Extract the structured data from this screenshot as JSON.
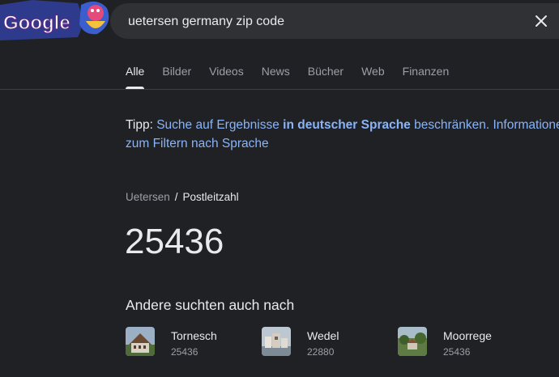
{
  "search": {
    "query": "uetersen germany zip code",
    "clear_icon": "close-icon"
  },
  "logo": {
    "text": "Google",
    "style": "doodle"
  },
  "tabs": [
    {
      "label": "Alle",
      "active": true
    },
    {
      "label": "Bilder",
      "active": false
    },
    {
      "label": "Videos",
      "active": false
    },
    {
      "label": "News",
      "active": false
    },
    {
      "label": "Bücher",
      "active": false
    },
    {
      "label": "Web",
      "active": false
    },
    {
      "label": "Finanzen",
      "active": false
    }
  ],
  "tip": {
    "prefix": "Tipp:",
    "link_start": "Suche auf Ergebnisse",
    "link_bold": "in deutscher Sprache",
    "link_end": "beschränken.",
    "link2": "Informationen zum Filtern nach Sprache"
  },
  "result": {
    "breadcrumb": [
      "Uetersen",
      "Postleitzahl"
    ],
    "separator": "/",
    "answer": "25436"
  },
  "related": {
    "title": "Andere suchten auch nach",
    "items": [
      {
        "name": "Tornesch",
        "zip": "25436"
      },
      {
        "name": "Wedel",
        "zip": "22880"
      },
      {
        "name": "Moorrege",
        "zip": "25436"
      }
    ]
  },
  "colors": {
    "background": "#202124",
    "link": "#8ab4f8",
    "text": "#e8eaed",
    "muted": "#9aa0a6"
  }
}
